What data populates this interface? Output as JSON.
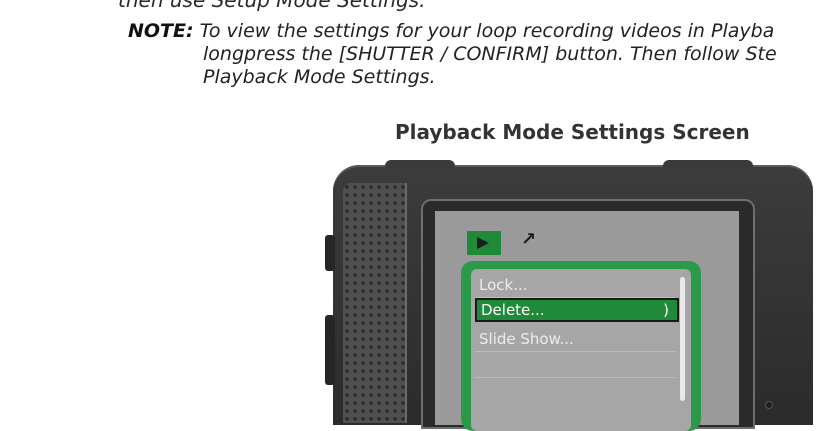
{
  "top_clipped_text": "then use Setup Mode Settings.",
  "note": {
    "label": "NOTE:",
    "line1": " To view the settings for your loop recording videos in Playba",
    "line2": "longpress the [SHUTTER / CONFIRM] button. Then follow Ste",
    "line3": "Playback Mode Settings."
  },
  "figure_caption": "Playback Mode Settings Screen",
  "camera_screen": {
    "tabs": [
      {
        "name": "playback-tab",
        "icon": "play-icon"
      },
      {
        "name": "setup-tab",
        "icon": "wrench-icon",
        "glyph": "↗"
      }
    ],
    "menu_items": [
      "Lock...",
      "Delete...",
      "Slide Show..."
    ],
    "selected_index": 1,
    "selected_arrow": ")",
    "accent_color": "#1f8a3a",
    "body_color": "#333333"
  }
}
